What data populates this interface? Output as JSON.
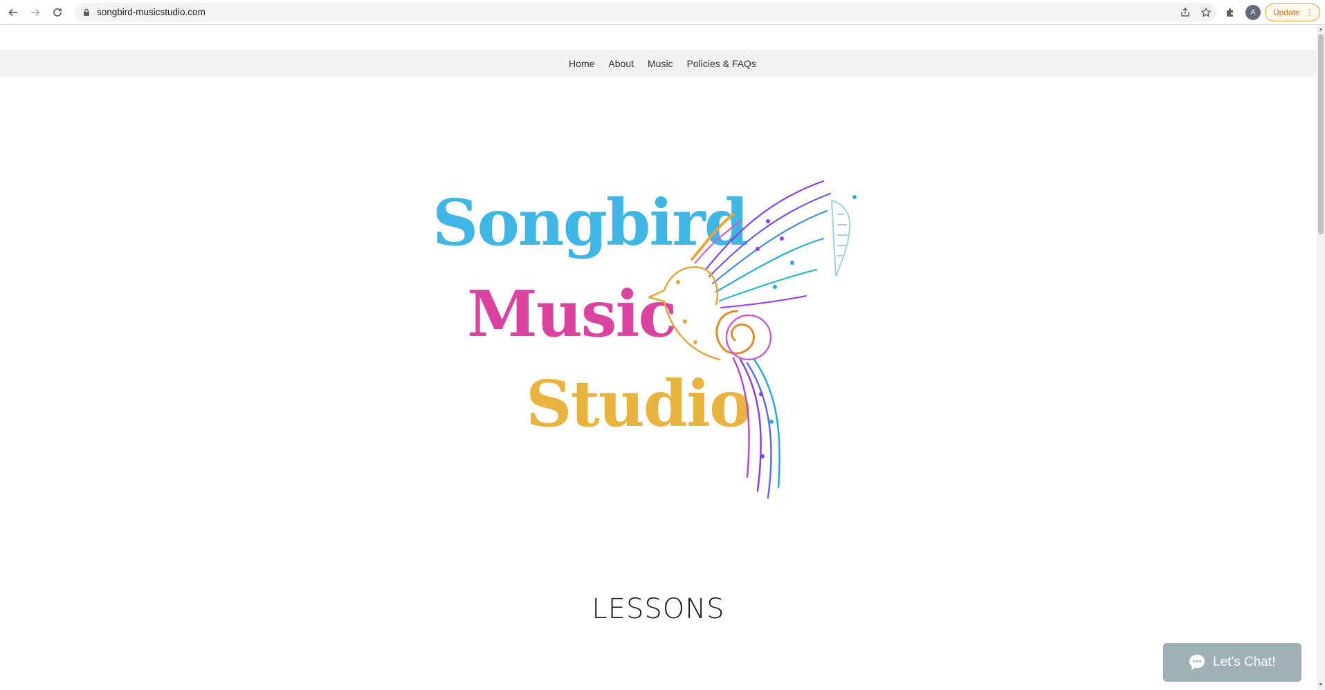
{
  "browser": {
    "url": "songbird-musicstudio.com",
    "avatar_initial": "A",
    "update_label": "Update"
  },
  "nav": {
    "items": [
      "Home",
      "About",
      "Music",
      "Policies & FAQs"
    ]
  },
  "logo": {
    "line1": "Songbird",
    "line2": "Music",
    "line3": "Studio",
    "colors": {
      "songbird": "#3fb6e3",
      "music": "#d8449f",
      "studio": "#e8b33f"
    }
  },
  "main": {
    "heading": "LESSONS"
  },
  "chat": {
    "label": "Let’s Chat!"
  }
}
